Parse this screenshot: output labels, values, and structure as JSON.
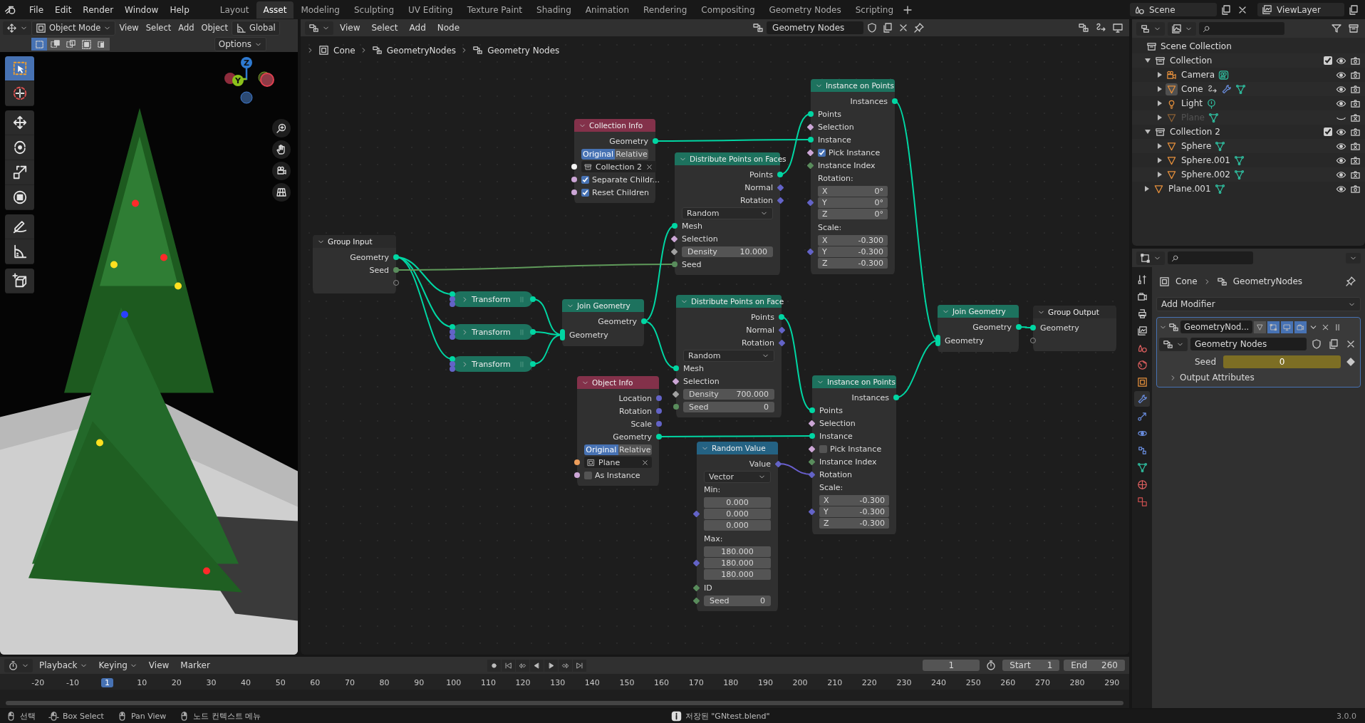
{
  "topbar": {
    "menus": [
      "File",
      "Edit",
      "Render",
      "Window",
      "Help"
    ],
    "workspaces": [
      {
        "label": "Layout",
        "selected": false
      },
      {
        "label": "Asset",
        "selected": true
      },
      {
        "label": "Modeling",
        "selected": false
      },
      {
        "label": "Sculpting",
        "selected": false
      },
      {
        "label": "UV Editing",
        "selected": false
      },
      {
        "label": "Texture Paint",
        "selected": false
      },
      {
        "label": "Shading",
        "selected": false
      },
      {
        "label": "Animation",
        "selected": false
      },
      {
        "label": "Rendering",
        "selected": false
      },
      {
        "label": "Compositing",
        "selected": false
      },
      {
        "label": "Geometry Nodes",
        "selected": false
      },
      {
        "label": "Scripting",
        "selected": false
      }
    ],
    "scene": "Scene",
    "view_layer": "ViewLayer"
  },
  "viewport": {
    "mode": "Object Mode",
    "menus": [
      "View",
      "Select",
      "Add",
      "Object"
    ],
    "orientation": "Global",
    "options": "Options",
    "select_modes": [
      {
        "kind": "set",
        "selected": true
      },
      {
        "kind": "extend",
        "selected": false
      },
      {
        "kind": "subtract",
        "selected": false
      },
      {
        "kind": "invert",
        "selected": false
      },
      {
        "kind": "intersect",
        "selected": false
      }
    ],
    "tool_groups": [
      [
        {
          "kind": "select_box",
          "selected": true
        },
        {
          "kind": "cursor",
          "selected": false
        }
      ],
      [
        {
          "kind": "move",
          "selected": false
        },
        {
          "kind": "rotate",
          "selected": false
        },
        {
          "kind": "scale",
          "selected": false
        },
        {
          "kind": "transform",
          "selected": false
        }
      ],
      [
        {
          "kind": "annotate",
          "selected": false
        },
        {
          "kind": "measure",
          "selected": false
        }
      ],
      [
        {
          "kind": "add_cube",
          "selected": false
        }
      ]
    ],
    "gizmo": [
      {
        "label": "Z",
        "color": "#2e7ad1"
      },
      {
        "label": "Y",
        "color": "#8bc11b"
      }
    ]
  },
  "node_editor": {
    "menus": [
      "View",
      "Select",
      "Add",
      "Node"
    ],
    "tree_name": "Geometry Nodes",
    "breadcrumb": [
      "Cone",
      "GeometryNodes",
      "Geometry Nodes"
    ],
    "nodes": [
      {
        "title": "Group Input",
        "kind": "group",
        "rows": [
          {
            "kind": "out",
            "label": "Geometry",
            "socket": {
              "kind": "geometry"
            }
          },
          {
            "kind": "out",
            "label": "Seed",
            "socket": {
              "kind": "int"
            }
          },
          {
            "kind": "virtual_out",
            "socket": {
              "kind": "virtual"
            }
          }
        ]
      },
      {
        "title": "Collection Info",
        "kind": "input",
        "rows": [
          {
            "kind": "out",
            "label": "Geometry",
            "socket": {
              "kind": "geometry"
            }
          },
          {
            "kind": "toggle",
            "options": [
              {
                "label": "Original",
                "selected": true
              },
              {
                "label": "Relative",
                "selected": false
              }
            ]
          },
          {
            "kind": "object",
            "value": "Collection 2",
            "socket": {
              "kind": "collection"
            }
          },
          {
            "kind": "check",
            "label": "Separate Childr...",
            "checked": true,
            "socket": {
              "kind": "bool"
            }
          },
          {
            "kind": "check",
            "label": "Reset Children",
            "checked": true,
            "socket": {
              "kind": "bool"
            }
          }
        ]
      },
      {
        "title": "Distribute Points on Faces",
        "kind": "geometry",
        "rows": [
          {
            "kind": "out",
            "label": "Points",
            "socket": {
              "kind": "geometry"
            }
          },
          {
            "kind": "out",
            "label": "Normal",
            "socket": {
              "kind": "vector_field"
            }
          },
          {
            "kind": "out",
            "label": "Rotation",
            "socket": {
              "kind": "vector_field"
            }
          },
          {
            "kind": "dropdown",
            "value": "Random"
          },
          {
            "kind": "in",
            "label": "Mesh",
            "socket": {
              "kind": "geometry"
            }
          },
          {
            "kind": "in",
            "label": "Selection",
            "socket": {
              "kind": "bool_field"
            }
          },
          {
            "kind": "field",
            "label": "Density",
            "value": "10.000",
            "socket": {
              "kind": "float_field"
            }
          },
          {
            "kind": "in",
            "label": "Seed",
            "socket": {
              "kind": "int"
            }
          }
        ]
      },
      {
        "title": "Instance on Points",
        "kind": "geometry",
        "rows": [
          {
            "kind": "out",
            "label": "Instances",
            "socket": {
              "kind": "geometry"
            }
          },
          {
            "kind": "in",
            "label": "Points",
            "socket": {
              "kind": "geometry"
            }
          },
          {
            "kind": "in",
            "label": "Selection",
            "socket": {
              "kind": "bool_field"
            }
          },
          {
            "kind": "in",
            "label": "Instance",
            "socket": {
              "kind": "geometry"
            }
          },
          {
            "kind": "check",
            "label": "Pick Instance",
            "checked": true,
            "socket": {
              "kind": "bool_field"
            }
          },
          {
            "kind": "in",
            "label": "Instance Index",
            "socket": {
              "kind": "int_field"
            }
          },
          {
            "kind": "heading",
            "label": "Rotation:"
          },
          {
            "kind": "vector",
            "socket": {
              "kind": "vector_field"
            },
            "fields": [
              {
                "label": "X",
                "value": "0°"
              },
              {
                "label": "Y",
                "value": "0°"
              },
              {
                "label": "Z",
                "value": "0°"
              }
            ]
          },
          {
            "kind": "heading",
            "label": "Scale:"
          },
          {
            "kind": "vector",
            "socket": {
              "kind": "vector_field"
            },
            "fields": [
              {
                "label": "X",
                "value": "-0.300"
              },
              {
                "label": "Y",
                "value": "-0.300"
              },
              {
                "label": "Z",
                "value": "-0.300"
              }
            ]
          }
        ]
      },
      {
        "title": "Transform",
        "kind": "collapsed"
      },
      {
        "title": "Transform",
        "kind": "collapsed"
      },
      {
        "title": "Transform",
        "kind": "collapsed"
      },
      {
        "title": "Join Geometry",
        "kind": "geometry",
        "rows": [
          {
            "kind": "out",
            "label": "Geometry",
            "socket": {
              "kind": "geometry"
            }
          },
          {
            "kind": "in",
            "label": "Geometry",
            "socket": {
              "kind": "multi"
            }
          }
        ]
      },
      {
        "title": "Distribute Points on Face",
        "kind": "geometry",
        "rows": [
          {
            "kind": "out",
            "label": "Points",
            "socket": {
              "kind": "geometry"
            }
          },
          {
            "kind": "out",
            "label": "Normal",
            "socket": {
              "kind": "vector_field"
            }
          },
          {
            "kind": "out",
            "label": "Rotation",
            "socket": {
              "kind": "vector_field"
            }
          },
          {
            "kind": "dropdown",
            "value": "Random"
          },
          {
            "kind": "in",
            "label": "Mesh",
            "socket": {
              "kind": "geometry"
            }
          },
          {
            "kind": "in",
            "label": "Selection",
            "socket": {
              "kind": "bool_field"
            }
          },
          {
            "kind": "field",
            "label": "Density",
            "value": "700.000",
            "socket": {
              "kind": "float_field"
            }
          },
          {
            "kind": "field",
            "label": "Seed",
            "value": "0",
            "socket": {
              "kind": "int"
            }
          }
        ]
      },
      {
        "title": "Object Info",
        "kind": "input",
        "rows": [
          {
            "kind": "out",
            "label": "Location",
            "socket": {
              "kind": "vector"
            }
          },
          {
            "kind": "out",
            "label": "Rotation",
            "socket": {
              "kind": "vector"
            }
          },
          {
            "kind": "out",
            "label": "Scale",
            "socket": {
              "kind": "vector"
            }
          },
          {
            "kind": "out",
            "label": "Geometry",
            "socket": {
              "kind": "geometry"
            }
          },
          {
            "kind": "toggle",
            "options": [
              {
                "label": "Original",
                "selected": true
              },
              {
                "label": "Relative",
                "selected": false
              }
            ]
          },
          {
            "kind": "object",
            "value": "Plane",
            "socket": {
              "kind": "object"
            }
          },
          {
            "kind": "check",
            "label": "As Instance",
            "checked": false,
            "socket": {
              "kind": "bool"
            }
          }
        ]
      },
      {
        "title": "Random Value",
        "kind": "converter",
        "rows": [
          {
            "kind": "out",
            "label": "Value",
            "socket": {
              "kind": "vector_field"
            }
          },
          {
            "kind": "dropdown",
            "value": "Vector"
          },
          {
            "kind": "heading",
            "label": "Min:"
          },
          {
            "kind": "vector",
            "socket": {
              "kind": "vector_field"
            },
            "fields": [
              {
                "value": "0.000"
              },
              {
                "value": "0.000"
              },
              {
                "value": "0.000"
              }
            ]
          },
          {
            "kind": "heading",
            "label": "Max:"
          },
          {
            "kind": "vector",
            "socket": {
              "kind": "vector_field"
            },
            "fields": [
              {
                "value": "180.000"
              },
              {
                "value": "180.000"
              },
              {
                "value": "180.000"
              }
            ]
          },
          {
            "kind": "in",
            "label": "ID",
            "socket": {
              "kind": "int_field"
            }
          },
          {
            "kind": "field",
            "label": "Seed",
            "value": "0",
            "socket": {
              "kind": "int_field"
            }
          }
        ]
      },
      {
        "title": "Instance on Points",
        "kind": "geometry",
        "rows": [
          {
            "kind": "out",
            "label": "Instances",
            "socket": {
              "kind": "geometry"
            }
          },
          {
            "kind": "in",
            "label": "Points",
            "socket": {
              "kind": "geometry"
            }
          },
          {
            "kind": "in",
            "label": "Selection",
            "socket": {
              "kind": "bool_field"
            }
          },
          {
            "kind": "in",
            "label": "Instance",
            "socket": {
              "kind": "geometry"
            }
          },
          {
            "kind": "check",
            "label": "Pick Instance",
            "checked": false,
            "socket": {
              "kind": "bool_field"
            }
          },
          {
            "kind": "in",
            "label": "Instance Index",
            "socket": {
              "kind": "int_field"
            }
          },
          {
            "kind": "in",
            "label": "Rotation",
            "socket": {
              "kind": "vector_field"
            }
          },
          {
            "kind": "heading",
            "label": "Scale:"
          },
          {
            "kind": "vector",
            "socket": {
              "kind": "vector_field"
            },
            "fields": [
              {
                "label": "X",
                "value": "-0.300"
              },
              {
                "label": "Y",
                "value": "-0.300"
              },
              {
                "label": "Z",
                "value": "-0.300"
              }
            ]
          }
        ]
      },
      {
        "title": "Join Geometry",
        "kind": "geometry",
        "rows": [
          {
            "kind": "out",
            "label": "Geometry",
            "socket": {
              "kind": "geometry"
            }
          },
          {
            "kind": "in",
            "label": "Geometry",
            "socket": {
              "kind": "multi"
            }
          }
        ]
      },
      {
        "title": "Group Output",
        "kind": "group",
        "rows": [
          {
            "kind": "in",
            "label": "Geometry",
            "socket": {
              "kind": "geometry"
            }
          },
          {
            "kind": "virtual_in",
            "socket": {
              "kind": "virtual"
            }
          }
        ]
      }
    ]
  },
  "outliner": {
    "items": [
      {
        "name": "Scene Collection",
        "kind": "scene_collection",
        "children": [
          {
            "name": "Collection",
            "kind": "collection",
            "expanded": true,
            "checked": true,
            "visible": true,
            "renderable": true,
            "children": [
              {
                "name": "Camera",
                "kind": "camera",
                "expanded": false,
                "selected": false,
                "visible": true,
                "renderable": true,
                "extras": [
                  {
                    "kind": "camera_data"
                  }
                ]
              },
              {
                "name": "Cone",
                "kind": "mesh",
                "expanded": false,
                "selected": true,
                "visible": true,
                "renderable": true,
                "extras": [
                  {
                    "kind": "constraint"
                  },
                  {
                    "kind": "wrench"
                  },
                  {
                    "kind": "mesh_data"
                  }
                ]
              },
              {
                "name": "Light",
                "kind": "light",
                "expanded": false,
                "selected": false,
                "visible": true,
                "renderable": true,
                "extras": [
                  {
                    "kind": "light_data"
                  }
                ]
              },
              {
                "name": "Plane",
                "kind": "mesh",
                "expanded": false,
                "selected": false,
                "visible": false,
                "renderable": false,
                "extras": [
                  {
                    "kind": "mesh_data"
                  }
                ]
              }
            ]
          },
          {
            "name": "Collection 2",
            "kind": "collection",
            "expanded": true,
            "checked": true,
            "visible": true,
            "renderable": true,
            "children": [
              {
                "name": "Sphere",
                "kind": "mesh",
                "expanded": false,
                "selected": false,
                "visible": true,
                "renderable": false,
                "extras": [
                  {
                    "kind": "mesh_data"
                  }
                ]
              },
              {
                "name": "Sphere.001",
                "kind": "mesh",
                "expanded": false,
                "selected": false,
                "visible": true,
                "renderable": false,
                "extras": [
                  {
                    "kind": "mesh_data"
                  }
                ]
              },
              {
                "name": "Sphere.002",
                "kind": "mesh",
                "expanded": false,
                "selected": false,
                "visible": true,
                "renderable": false,
                "extras": [
                  {
                    "kind": "mesh_data"
                  }
                ]
              }
            ]
          },
          {
            "name": "Plane.001",
            "kind": "mesh",
            "expanded": false,
            "selected": false,
            "visible": true,
            "renderable": true,
            "extras": [
              {
                "kind": "mesh_data"
              }
            ]
          }
        ]
      }
    ]
  },
  "properties": {
    "tabs": [
      {
        "kind": "tool",
        "selected": false
      },
      {
        "kind": "render",
        "selected": false
      },
      {
        "kind": "output",
        "selected": false
      },
      {
        "kind": "view_layer",
        "selected": false
      },
      {
        "kind": "scene",
        "selected": false
      },
      {
        "kind": "world",
        "selected": false
      },
      {
        "kind": "object",
        "selected": false
      },
      {
        "kind": "modifiers",
        "selected": true
      },
      {
        "kind": "particles",
        "selected": false
      },
      {
        "kind": "physics",
        "selected": false
      },
      {
        "kind": "constraints",
        "selected": false
      },
      {
        "kind": "data",
        "selected": false
      },
      {
        "kind": "material",
        "selected": false
      },
      {
        "kind": "texture",
        "selected": false
      }
    ],
    "breadcrumb": [
      "Cone",
      "GeometryNodes"
    ],
    "add_modifier": "Add Modifier",
    "modifier": {
      "name": "GeometryNod...",
      "expanded": true,
      "toggles": [
        {
          "kind": "on_cage",
          "on": false
        },
        {
          "kind": "edit_mode",
          "on": true
        },
        {
          "kind": "viewport",
          "on": true
        },
        {
          "kind": "render",
          "on": true
        }
      ],
      "node_group": "Geometry Nodes",
      "inputs": [
        {
          "label": "Seed",
          "value": "0"
        }
      ],
      "subpanels": [
        {
          "label": "Output Attributes",
          "expanded": false
        }
      ]
    }
  },
  "timeline": {
    "menus": [
      {
        "label": "Playback",
        "dropdown": true
      },
      {
        "label": "Keying",
        "dropdown": true
      },
      {
        "label": "View",
        "dropdown": false
      },
      {
        "label": "Marker",
        "dropdown": false
      }
    ],
    "frame": "1",
    "start_label": "Start",
    "start": "1",
    "end_label": "End",
    "end": "260",
    "ticks": [
      {
        "label": "-20",
        "selected": false
      },
      {
        "label": "-10",
        "selected": false
      },
      {
        "label": "1",
        "selected": true
      },
      {
        "label": "10",
        "selected": false
      },
      {
        "label": "20",
        "selected": false
      },
      {
        "label": "30",
        "selected": false
      },
      {
        "label": "40",
        "selected": false
      },
      {
        "label": "50",
        "selected": false
      },
      {
        "label": "60",
        "selected": false
      },
      {
        "label": "70",
        "selected": false
      },
      {
        "label": "80",
        "selected": false
      },
      {
        "label": "90",
        "selected": false
      },
      {
        "label": "100",
        "selected": false
      },
      {
        "label": "110",
        "selected": false
      },
      {
        "label": "120",
        "selected": false
      },
      {
        "label": "130",
        "selected": false
      },
      {
        "label": "140",
        "selected": false
      },
      {
        "label": "150",
        "selected": false
      },
      {
        "label": "160",
        "selected": false
      },
      {
        "label": "170",
        "selected": false
      },
      {
        "label": "180",
        "selected": false
      },
      {
        "label": "190",
        "selected": false
      },
      {
        "label": "200",
        "selected": false
      },
      {
        "label": "210",
        "selected": false
      },
      {
        "label": "220",
        "selected": false
      },
      {
        "label": "230",
        "selected": false
      },
      {
        "label": "240",
        "selected": false
      },
      {
        "label": "250",
        "selected": false
      },
      {
        "label": "260",
        "selected": false
      },
      {
        "label": "270",
        "selected": false
      },
      {
        "label": "280",
        "selected": false
      },
      {
        "label": "290",
        "selected": false
      }
    ]
  },
  "status_bar": {
    "items": [
      {
        "kind": "left",
        "label": "선택"
      },
      {
        "kind": "left_drag",
        "label": "Box Select"
      },
      {
        "kind": "middle",
        "label": "Pan View"
      },
      {
        "kind": "right",
        "label": "노드 컨텍스트 메뉴"
      }
    ],
    "message": "저장된 \"GNtest.blend\"",
    "version": "3.0.0"
  }
}
